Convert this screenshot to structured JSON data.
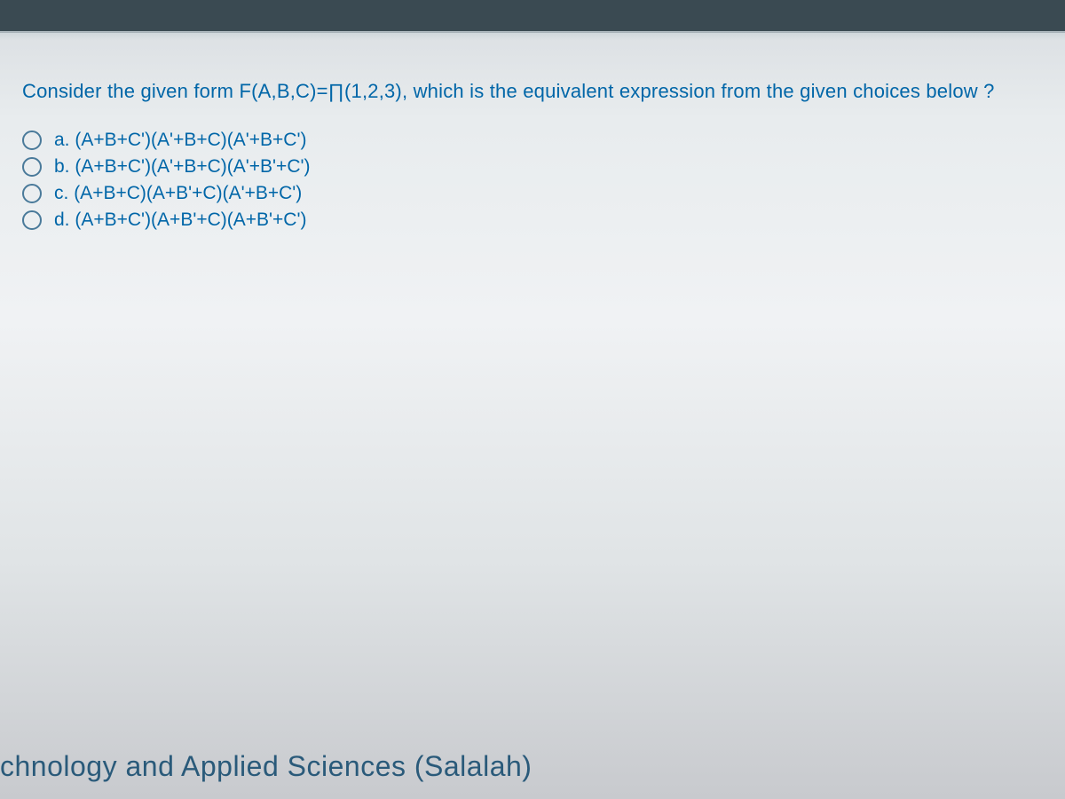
{
  "question": {
    "prompt": "Consider the given form F(A,B,C)=∏(1,2,3), which is the equivalent expression from the given choices below ?",
    "options": [
      {
        "letter": "a.",
        "text": "(A+B+C')(A'+B+C)(A'+B+C')"
      },
      {
        "letter": "b.",
        "text": "(A+B+C')(A'+B+C)(A'+B'+C')"
      },
      {
        "letter": "c.",
        "text": "(A+B+C)(A+B'+C)(A'+B+C')"
      },
      {
        "letter": "d.",
        "text": "(A+B+C')(A+B'+C)(A+B'+C')"
      }
    ]
  },
  "footer": {
    "text": "chnology and Applied Sciences (Salalah)"
  }
}
